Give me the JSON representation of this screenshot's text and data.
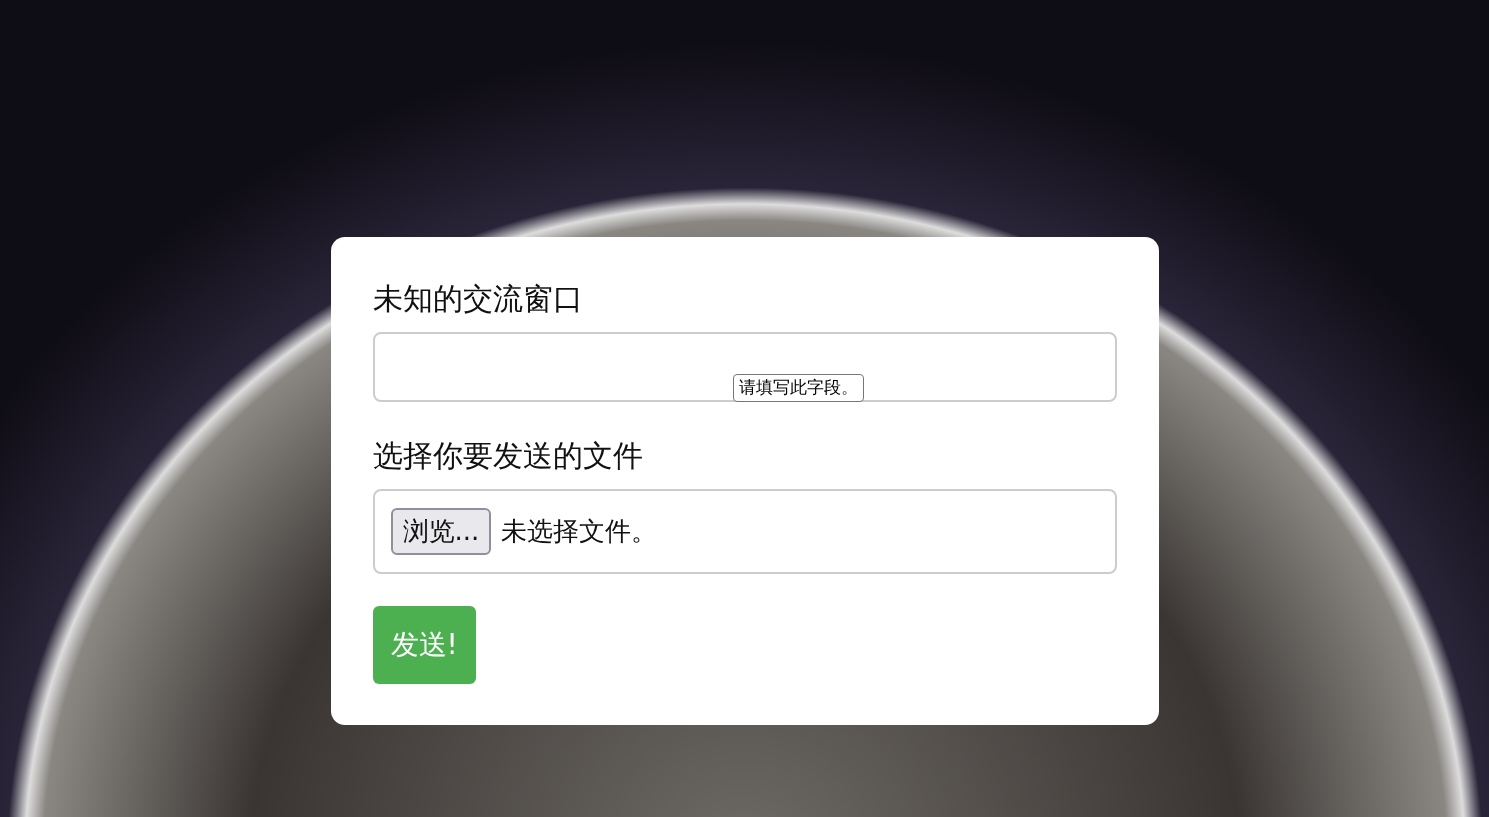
{
  "form": {
    "fields": [
      {
        "kind": "text",
        "label": "未知的交流窗口",
        "validation_message": "请填写此字段。"
      },
      {
        "kind": "file",
        "label": "选择你要发送的文件",
        "button": "浏览...",
        "status": "未选择文件。"
      }
    ],
    "submit": "发送!"
  }
}
